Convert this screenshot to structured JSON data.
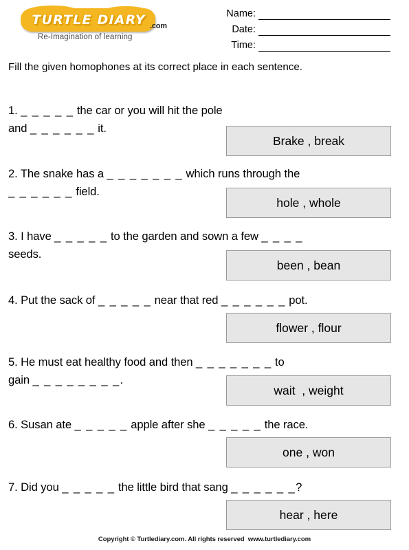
{
  "logo": {
    "wordmark": "TURTLE DIARY",
    "dotcom": ".com",
    "tagline": "Re-Imagination of learning",
    "badge_color": "#F5B721"
  },
  "fields": [
    {
      "label": "Name:"
    },
    {
      "label": "Date:"
    },
    {
      "label": "Time:"
    }
  ],
  "instruction": "Fill the given homophones at its correct place in each sentence.",
  "questions": [
    {
      "number": "1.",
      "line1_a": "1. ",
      "blank1": "_ _ _ _ _",
      "line1_b": " the car or you will hit the pole",
      "line2_a": "and ",
      "blank2": "_ _ _ _ _ _",
      "line2_b": " it.",
      "answer": "Brake , break"
    },
    {
      "number": "2.",
      "line1_a": "2. The snake has a ",
      "blank1": "_ _ _ _ _ _ _",
      "line1_b": " which runs through the",
      "line2_a": "",
      "blank2": "_ _ _ _ _ _",
      "line2_b": " field.",
      "answer": "hole , whole"
    },
    {
      "number": "3.",
      "line1_a": "3. I have ",
      "blank1": "_ _ _ _ _",
      "line1_b": " to the garden and sown a few ",
      "blank2": "_ _ _ _",
      "line2_a": "seeds.",
      "line2_b": "",
      "answer": "been , bean"
    },
    {
      "number": "4.",
      "line1_a": "4. Put the sack of ",
      "blank1": "_ _ _ _ _",
      "line1_b": " near that red ",
      "blank2": "_ _ _ _ _ _",
      "line2_a": " pot.",
      "line2_b": "",
      "answer": "flower , flour"
    },
    {
      "number": "5.",
      "line1_a": "5. He must eat healthy food and then ",
      "blank1": "_ _ _ _ _ _ _",
      "line1_b": "  to",
      "line2_a": "gain ",
      "blank2": "_ _ _ _ _ _ _ _",
      "line2_b": ".",
      "answer": "wait  , weight"
    },
    {
      "number": "6.",
      "line1_a": "6. Susan ate ",
      "blank1": "_ _ _ _ _",
      "line1_b": " apple after she ",
      "blank2": "_ _ _ _ _",
      "line2_a": " the race.",
      "line2_b": "",
      "answer": "one , won"
    },
    {
      "number": "7.",
      "line1_a": "7. Did you ",
      "blank1": "_ _ _ _ _",
      "line1_b": " the little bird that sang ",
      "blank2": "_ _ _ _ _ _",
      "line2_a": "?",
      "line2_b": "",
      "answer": "hear , here"
    }
  ],
  "footer": "Copyright © Turtlediary.com. All rights reserved  www.turtlediary.com"
}
